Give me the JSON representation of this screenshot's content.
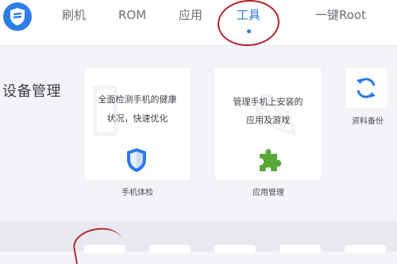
{
  "nav": {
    "items": [
      {
        "label": "刷机"
      },
      {
        "label": "ROM"
      },
      {
        "label": "应用"
      },
      {
        "label": "工具",
        "active": true
      },
      {
        "label": "一键Root"
      }
    ]
  },
  "section": {
    "title": "设备管理"
  },
  "cards": {
    "phone_check": {
      "desc_line1": "全面检测手机的健康",
      "desc_line2": "状况，快速优化",
      "label": "手机体检",
      "icon": "shield-icon"
    },
    "app_manage": {
      "desc_line1": "管理手机上安装的",
      "desc_line2": "应用及游戏",
      "label": "应用管理",
      "icon": "puzzle-icon"
    },
    "backup": {
      "label": "资料备份",
      "icon": "sync-icon"
    }
  },
  "colors": {
    "accent": "#2d7ae6",
    "annotation_red": "#b3212b",
    "puzzle_green": "#5aa83a"
  }
}
